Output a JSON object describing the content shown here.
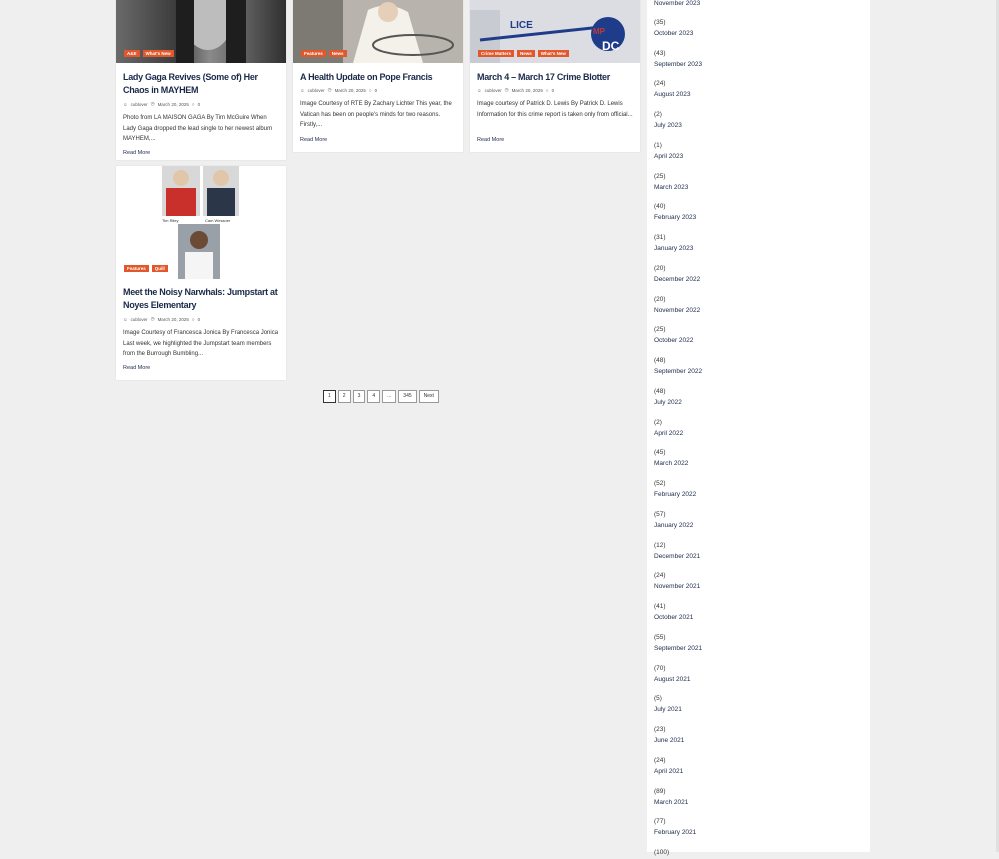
{
  "posts": [
    {
      "cats": [
        "A&E",
        "What's New"
      ],
      "title": "Lady Gaga Revives (Some of) Her Chaos in MAYHEM",
      "author": "cublover",
      "date": "March 20, 2025",
      "comments": "0",
      "excerpt": "Photo from LA MAISON GAGA By Tim McGuire When Lady Gaga dropped the lead single to her newest album MAYHEM,...",
      "read_more": "Read More"
    },
    {
      "cats": [
        "Features",
        "News"
      ],
      "title": "A Health Update on Pope Francis",
      "author": "cublover",
      "date": "March 20, 2025",
      "comments": "0",
      "excerpt": "Image Courtesy of RTE By Zachary Lichter This year, the Vatican has been on people's minds for two reasons. Firstly,...",
      "read_more": "Read More"
    },
    {
      "cats": [
        "Crime Matters",
        "News",
        "What's New"
      ],
      "title": "March 4 – March 17 Crime Blotter",
      "author": "cublover",
      "date": "March 20, 2025",
      "comments": "0",
      "excerpt": "Image courtesy of Patrick D. Lewis By Patrick D. Lewis Information for this crime report is taken only from official...",
      "read_more": "Read More"
    },
    {
      "cats": [
        "Features",
        "Quill"
      ],
      "title": "Meet the Noisy Narwhals: Jumpstart at Noyes Elementary",
      "author": "cublover",
      "date": "March 20, 2025",
      "comments": "0",
      "excerpt": "Image Courtesy of Francesca Jonica By Francesca Jonica Last week, we highlighted the Jumpstart team members from the Burrough Bumbling...",
      "read_more": "Read More",
      "photo_names": [
        "Tim Riley",
        "Cam Wessner"
      ]
    }
  ],
  "pagination": [
    "1",
    "2",
    "3",
    "4",
    "...",
    "345",
    "Next"
  ],
  "archives": [
    {
      "count": "",
      "label": "November 2023"
    },
    {
      "count": "(35)",
      "label": "October 2023"
    },
    {
      "count": "(43)",
      "label": "September 2023"
    },
    {
      "count": "(24)",
      "label": "August 2023"
    },
    {
      "count": "(2)",
      "label": "July 2023"
    },
    {
      "count": "(1)",
      "label": "April 2023"
    },
    {
      "count": "(25)",
      "label": "March 2023"
    },
    {
      "count": "(40)",
      "label": "February 2023"
    },
    {
      "count": "(31)",
      "label": "January 2023"
    },
    {
      "count": "(20)",
      "label": "December 2022"
    },
    {
      "count": "(20)",
      "label": "November 2022"
    },
    {
      "count": "(25)",
      "label": "October 2022"
    },
    {
      "count": "(48)",
      "label": "September 2022"
    },
    {
      "count": "(48)",
      "label": "July 2022"
    },
    {
      "count": "(2)",
      "label": "April 2022"
    },
    {
      "count": "(45)",
      "label": "March 2022"
    },
    {
      "count": "(52)",
      "label": "February 2022"
    },
    {
      "count": "(57)",
      "label": "January 2022"
    },
    {
      "count": "(12)",
      "label": "December 2021"
    },
    {
      "count": "(24)",
      "label": "November 2021"
    },
    {
      "count": "(41)",
      "label": "October 2021"
    },
    {
      "count": "(55)",
      "label": "September 2021"
    },
    {
      "count": "(70)",
      "label": "August 2021"
    },
    {
      "count": "(5)",
      "label": "July 2021"
    },
    {
      "count": "(23)",
      "label": "June 2021"
    },
    {
      "count": "(24)",
      "label": "April 2021"
    },
    {
      "count": "(89)",
      "label": "March 2021"
    },
    {
      "count": "(77)",
      "label": "February 2021"
    },
    {
      "count": "(100)",
      "label": ""
    }
  ],
  "colors": {
    "accent": "#e0582b",
    "title": "#1b2a4a"
  },
  "icons": {
    "author": "user-icon",
    "date": "clock-icon",
    "comments": "comment-icon"
  }
}
